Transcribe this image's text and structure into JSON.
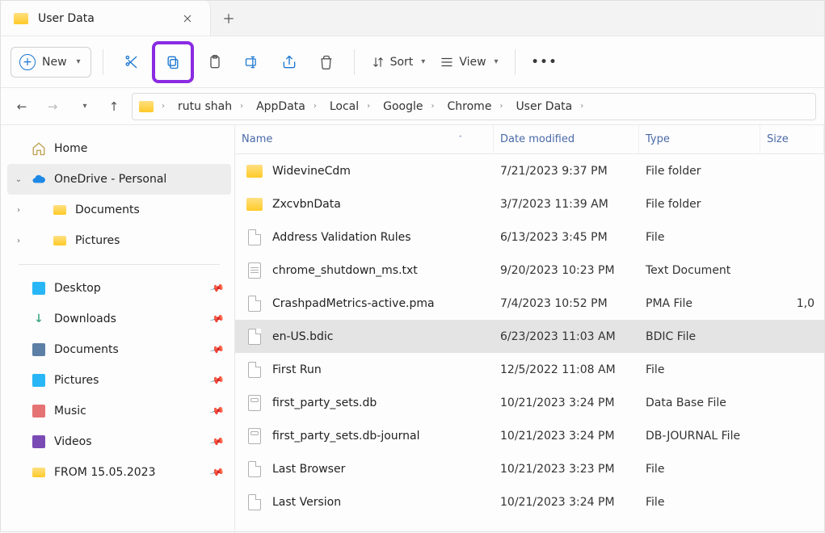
{
  "tab": {
    "title": "User Data"
  },
  "toolbar": {
    "new_label": "New",
    "sort_label": "Sort",
    "view_label": "View"
  },
  "breadcrumbs": [
    "rutu shah",
    "AppData",
    "Local",
    "Google",
    "Chrome",
    "User Data"
  ],
  "sidebar": {
    "home": "Home",
    "onedrive": "OneDrive - Personal",
    "onedrive_children": [
      "Documents",
      "Pictures"
    ],
    "quick": [
      "Desktop",
      "Downloads",
      "Documents",
      "Pictures",
      "Music",
      "Videos",
      "FROM 15.05.2023"
    ]
  },
  "columns": {
    "name": "Name",
    "date": "Date modified",
    "type": "Type",
    "size": "Size"
  },
  "files": [
    {
      "icon": "folder",
      "name": "WidevineCdm",
      "date": "7/21/2023 9:37 PM",
      "type": "File folder",
      "size": ""
    },
    {
      "icon": "folder",
      "name": "ZxcvbnData",
      "date": "3/7/2023 11:39 AM",
      "type": "File folder",
      "size": ""
    },
    {
      "icon": "file",
      "name": "Address Validation Rules",
      "date": "6/13/2023 3:45 PM",
      "type": "File",
      "size": ""
    },
    {
      "icon": "text",
      "name": "chrome_shutdown_ms.txt",
      "date": "9/20/2023 10:23 PM",
      "type": "Text Document",
      "size": ""
    },
    {
      "icon": "file",
      "name": "CrashpadMetrics-active.pma",
      "date": "7/4/2023 10:52 PM",
      "type": "PMA File",
      "size": "1,0"
    },
    {
      "icon": "file",
      "name": "en-US.bdic",
      "date": "6/23/2023 11:03 AM",
      "type": "BDIC File",
      "size": "",
      "selected": true
    },
    {
      "icon": "file",
      "name": "First Run",
      "date": "12/5/2022 11:08 AM",
      "type": "File",
      "size": ""
    },
    {
      "icon": "db",
      "name": "first_party_sets.db",
      "date": "10/21/2023 3:24 PM",
      "type": "Data Base File",
      "size": ""
    },
    {
      "icon": "db",
      "name": "first_party_sets.db-journal",
      "date": "10/21/2023 3:24 PM",
      "type": "DB-JOURNAL File",
      "size": ""
    },
    {
      "icon": "file",
      "name": "Last Browser",
      "date": "10/21/2023 3:23 PM",
      "type": "File",
      "size": ""
    },
    {
      "icon": "file",
      "name": "Last Version",
      "date": "10/21/2023 3:24 PM",
      "type": "File",
      "size": ""
    }
  ],
  "quick_icons": {
    "Desktop": {
      "bg": "#29b6f6"
    },
    "Downloads": {
      "glyph": "↓",
      "color": "#4a8"
    },
    "Documents": {
      "bg": "#5c7fa6"
    },
    "Pictures": {
      "bg": "#29b6f6"
    },
    "Music": {
      "bg": "#e57373"
    },
    "Videos": {
      "bg": "#7b4bb5"
    },
    "FROM 15.05.2023": {
      "folder": true
    }
  }
}
